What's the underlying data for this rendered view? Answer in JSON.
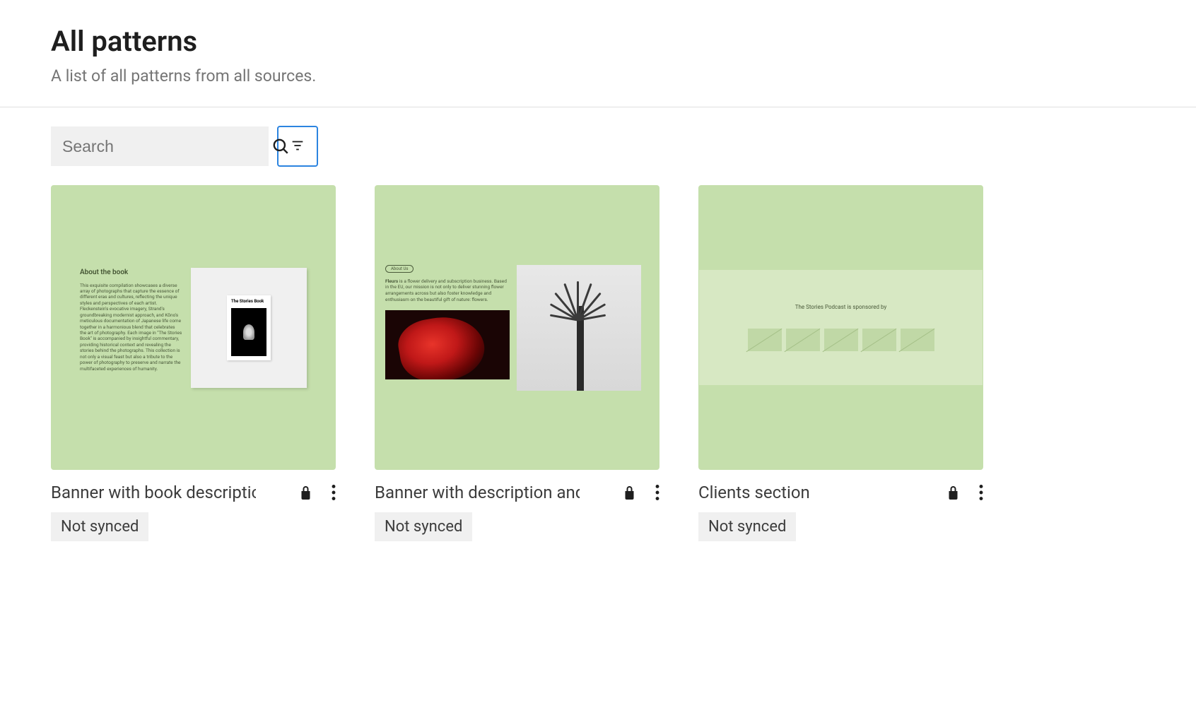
{
  "header": {
    "title": "All patterns",
    "subtitle": "A list of all patterns from all sources."
  },
  "toolbar": {
    "search_placeholder": "Search"
  },
  "patterns": [
    {
      "title": "Banner with book descriptio",
      "badge": "Not synced",
      "preview": {
        "heading": "About the book",
        "body": "This exquisite compilation showcases a diverse array of photographs that capture the essence of different eras and cultures, reflecting the unique styles and perspectives of each artist. Fleckenstein's evocative imagery, Strand's groundbreaking modernist approach, and Kōno's meticulous documentation of Japanese life come together in a harmonious blend that celebrates the art of photography. Each image in \"The Stories Book\" is accompanied by insightful commentary, providing historical context and revealing the stories behind the photographs. This collection is not only a visual feast but also a tribute to the power of photography to preserve and narrate the multifaceted experiences of humanity.",
        "book_label": "The Stories Book"
      }
    },
    {
      "title": "Banner with description and",
      "badge": "Not synced",
      "preview": {
        "badge": "About Us",
        "desc_bold": "Fleurs",
        "desc_rest": " is a flower delivery and subscription business. Based in the EU, our mission is not only to deliver stunning flower arrangements across but also foster knowledge and enthusiasm on the beautiful gift of nature: flowers."
      }
    },
    {
      "title": "Clients section",
      "badge": "Not synced",
      "preview": {
        "heading": "The Stories Podcast is sponsored by"
      }
    }
  ]
}
